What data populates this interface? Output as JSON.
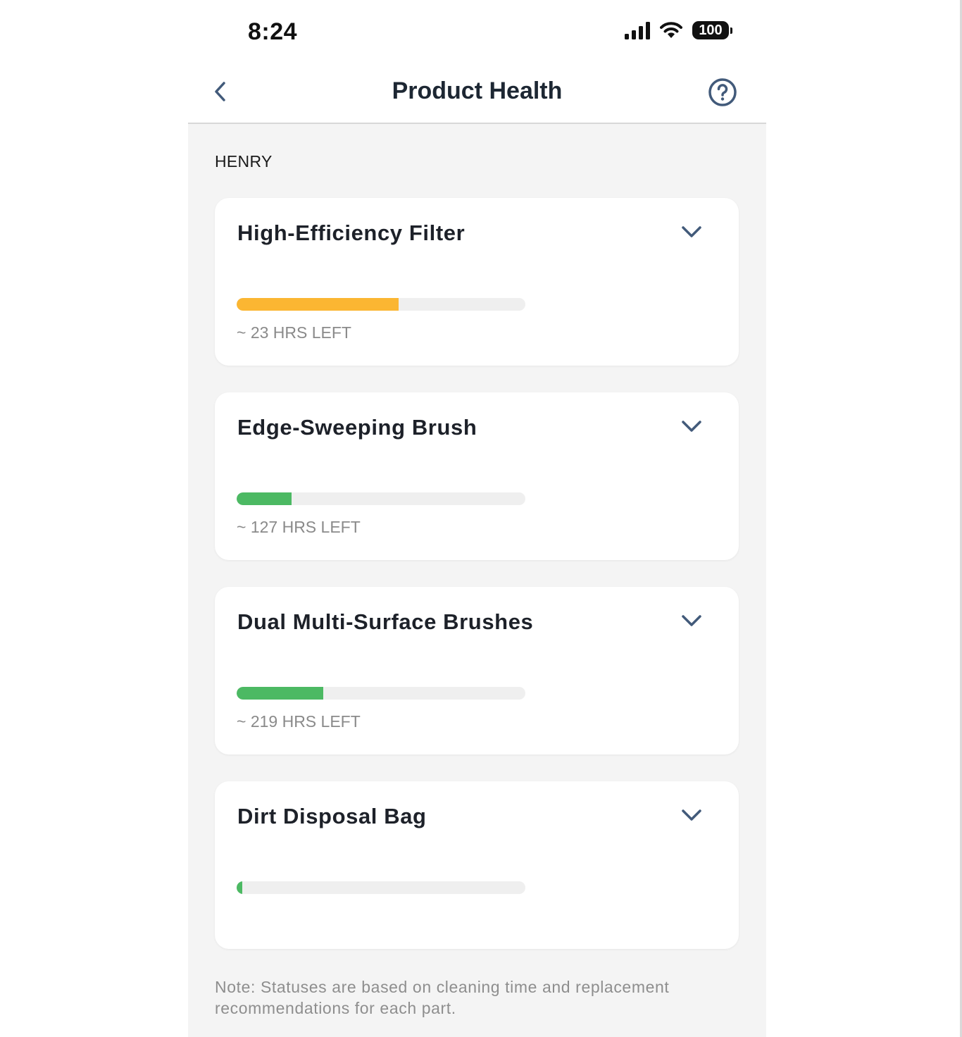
{
  "status_bar": {
    "time": "8:24",
    "battery": "100",
    "icons": [
      "signal-icon",
      "wifi-icon",
      "battery-icon"
    ]
  },
  "nav": {
    "title": "Product Health",
    "back_icon": "chevron-left-icon",
    "help_icon": "help-circle-icon"
  },
  "section": {
    "label": "HENRY"
  },
  "parts": [
    {
      "name": "High-Efficiency Filter",
      "hours_left": "~ 23 HRS LEFT",
      "progress": 0.56,
      "color": "#fbb632"
    },
    {
      "name": "Edge-Sweeping Brush",
      "hours_left": "~ 127 HRS LEFT",
      "progress": 0.19,
      "color": "#4cb963"
    },
    {
      "name": "Dual Multi-Surface Brushes",
      "hours_left": "~ 219 HRS LEFT",
      "progress": 0.3,
      "color": "#4cb963"
    },
    {
      "name": "Dirt Disposal Bag",
      "hours_left": "",
      "progress": 0.02,
      "color": "#4cb963"
    }
  ],
  "note": "Note: Statuses are based on cleaning time and replacement recommendations for each part.",
  "colors": {
    "accent": "#425a7a",
    "background": "#f4f4f4"
  }
}
